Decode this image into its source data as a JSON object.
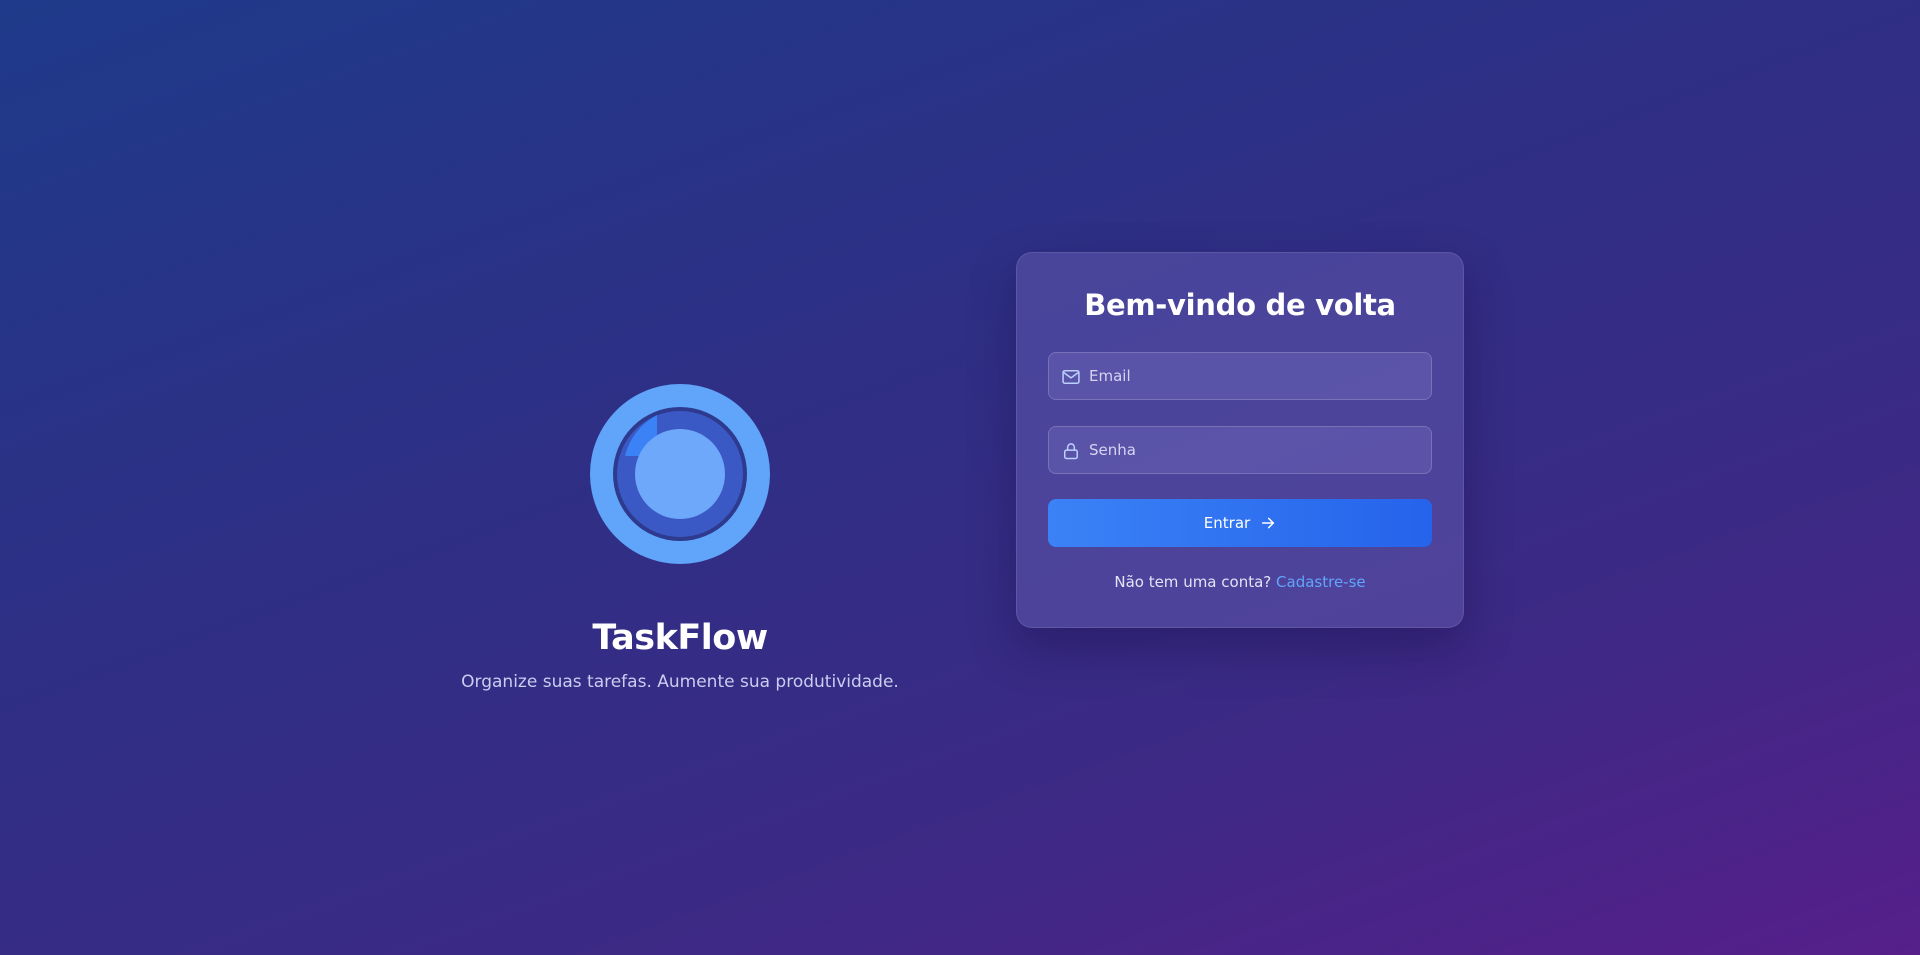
{
  "brand": {
    "name": "TaskFlow",
    "tagline": "Organize suas tarefas. Aumente sua produtividade.",
    "logo_icon": "target-progress-icon"
  },
  "login": {
    "title": "Bem-vindo de volta",
    "email": {
      "icon": "mail-icon",
      "placeholder": "Email",
      "value": ""
    },
    "password": {
      "icon": "lock-icon",
      "placeholder": "Senha",
      "value": ""
    },
    "submit": {
      "label": "Entrar",
      "icon": "arrow-right-icon"
    },
    "signup_prompt": "Não tem uma conta?",
    "signup_link": "Cadastre-se"
  },
  "colors": {
    "accent": "#3b82f6",
    "link": "#60a5fa",
    "logo_light": "#60a5fa",
    "logo_dark": "#3554c0"
  }
}
